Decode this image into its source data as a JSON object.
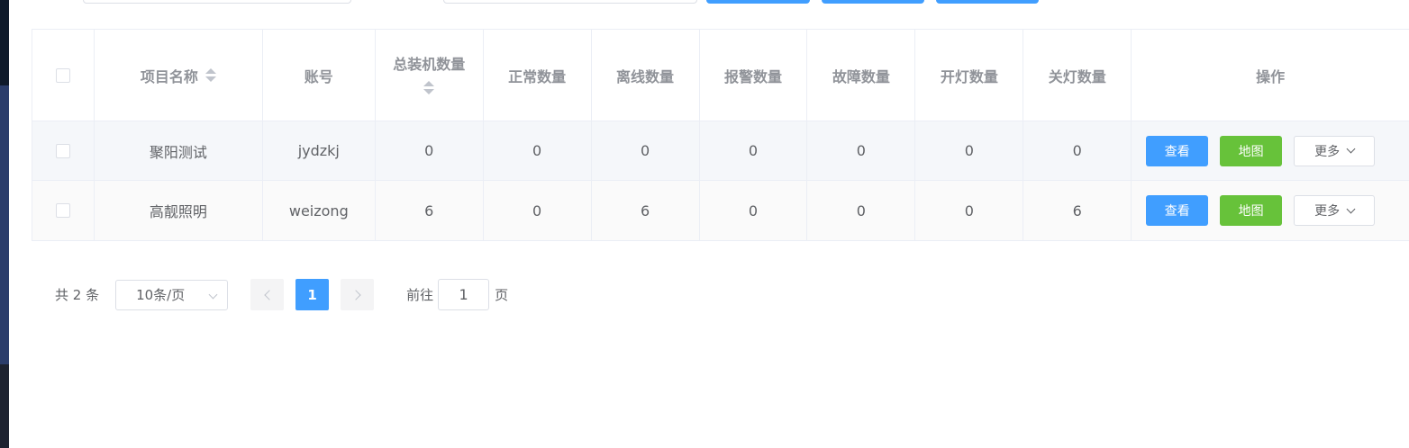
{
  "table": {
    "headers": {
      "name": "项目名称",
      "account": "账号",
      "total": "总装机数量",
      "normal": "正常数量",
      "offline": "离线数量",
      "alarm": "报警数量",
      "fault": "故障数量",
      "light_on": "开灯数量",
      "light_off": "关灯数量",
      "actions": "操作"
    },
    "rows": [
      {
        "name": "聚阳测试",
        "account": "jydzkj",
        "total": "0",
        "normal": "0",
        "offline": "0",
        "alarm": "0",
        "fault": "0",
        "light_on": "0",
        "light_off": "0",
        "view_label": "查看",
        "map_label": "地图",
        "more_label": "更多"
      },
      {
        "name": "高靓照明",
        "account": "weizong",
        "total": "6",
        "normal": "0",
        "offline": "6",
        "alarm": "0",
        "fault": "0",
        "light_on": "0",
        "light_off": "6",
        "view_label": "查看",
        "map_label": "地图",
        "more_label": "更多"
      }
    ]
  },
  "pagination": {
    "total_text": "共 2 条",
    "page_size": "10条/页",
    "current_page": "1",
    "goto_label": "前往",
    "goto_value": "1",
    "goto_suffix": "页"
  },
  "colors": {
    "primary": "#409eff",
    "success": "#67c23a"
  }
}
